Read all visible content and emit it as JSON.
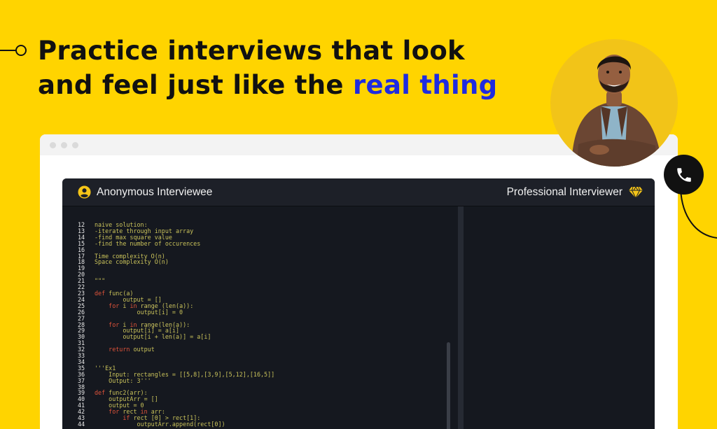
{
  "headline": {
    "line1": "Practice interviews that look",
    "line2_prefix": "and feel just like the ",
    "line2_accent": "real thing"
  },
  "colors": {
    "background": "#FFD400",
    "accent_text": "#1F2BE0",
    "editor_bg": "#15181F",
    "editor_header": "#1D2028",
    "icon_yellow": "#F5C518"
  },
  "editor": {
    "left_participant": "Anonymous Interviewee",
    "right_participant": "Professional Interviewer",
    "left_icon": "user-circle-icon",
    "right_icon": "diamond-icon",
    "lines": [
      {
        "n": "12",
        "text": "naive solution:"
      },
      {
        "n": "13",
        "text": "-iterate through input array"
      },
      {
        "n": "14",
        "text": "-find max square value"
      },
      {
        "n": "15",
        "text": "-find the number of occurences"
      },
      {
        "n": "16",
        "text": ""
      },
      {
        "n": "17",
        "text": "Time complexity O(n)"
      },
      {
        "n": "18",
        "text": "Space complexity O(n)"
      },
      {
        "n": "19",
        "text": ""
      },
      {
        "n": "20",
        "text": ""
      },
      {
        "n": "21",
        "text": "\"\"\""
      },
      {
        "n": "22",
        "text": ""
      },
      {
        "n": "23",
        "text": "def func(a)"
      },
      {
        "n": "24",
        "text": "        output = []"
      },
      {
        "n": "25",
        "text": "    for i in range (len(a)):"
      },
      {
        "n": "26",
        "text": "            output[i] = 0"
      },
      {
        "n": "27",
        "text": ""
      },
      {
        "n": "28",
        "text": "    for i in range(len(a)):"
      },
      {
        "n": "29",
        "text": "        output[i] = a[i]"
      },
      {
        "n": "30",
        "text": "        output[i + len(a)] = a[i]"
      },
      {
        "n": "31",
        "text": ""
      },
      {
        "n": "32",
        "text": "    return output"
      },
      {
        "n": "33",
        "text": ""
      },
      {
        "n": "34",
        "text": ""
      },
      {
        "n": "35",
        "text": "'''Ex1"
      },
      {
        "n": "36",
        "text": "    Input: rectangles = [[5,8],[3,9],[5,12],[16,5]]"
      },
      {
        "n": "37",
        "text": "    Output: 3'''"
      },
      {
        "n": "38",
        "text": ""
      },
      {
        "n": "39",
        "text": "def func2(arr):"
      },
      {
        "n": "40",
        "text": "    outputArr = []"
      },
      {
        "n": "41",
        "text": "    output = 0"
      },
      {
        "n": "42",
        "text": "    for rect in arr:"
      },
      {
        "n": "43",
        "text": "        if rect [0] > rect[1]:"
      },
      {
        "n": "44",
        "text": "            outputArr.append(rect[0])"
      }
    ]
  },
  "call": {
    "icon": "phone-icon"
  }
}
